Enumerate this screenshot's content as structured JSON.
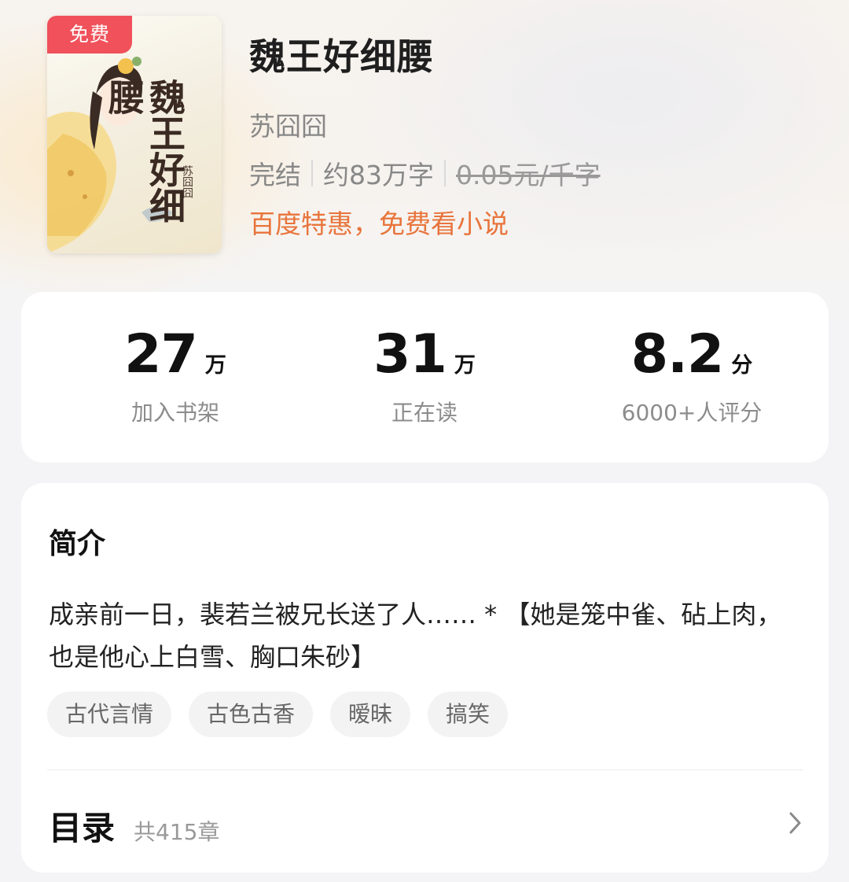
{
  "book": {
    "badge": "免费",
    "cover_title": "魏王好细腰",
    "cover_author": "苏囧囧",
    "title": "魏王好细腰",
    "author": "苏囧囧",
    "status": "完结",
    "word_count": "约83万字",
    "price": "0.05元/千字",
    "promo": "百度特惠，免费看小说"
  },
  "stats": [
    {
      "value": "27",
      "unit": "万",
      "label": "加入书架"
    },
    {
      "value": "31",
      "unit": "万",
      "label": "正在读"
    },
    {
      "value": "8.2",
      "unit": "分",
      "label": "6000+人评分"
    }
  ],
  "intro": {
    "heading": "简介",
    "text": "成亲前一日，裴若兰被兄长送了人…… * 【她是笼中雀、砧上肉，也是他心上白雪、胸口朱砂】",
    "tags": [
      "古代言情",
      "古色古香",
      "暧昧",
      "搞笑"
    ]
  },
  "toc": {
    "title": "目录",
    "count": "共415章"
  },
  "colors": {
    "badge": "#f0515a",
    "promo": "#e8743b",
    "card": "#ffffff",
    "background": "#f4f4f6"
  },
  "icons": {
    "toc_chevron": "chevron-right-icon"
  }
}
